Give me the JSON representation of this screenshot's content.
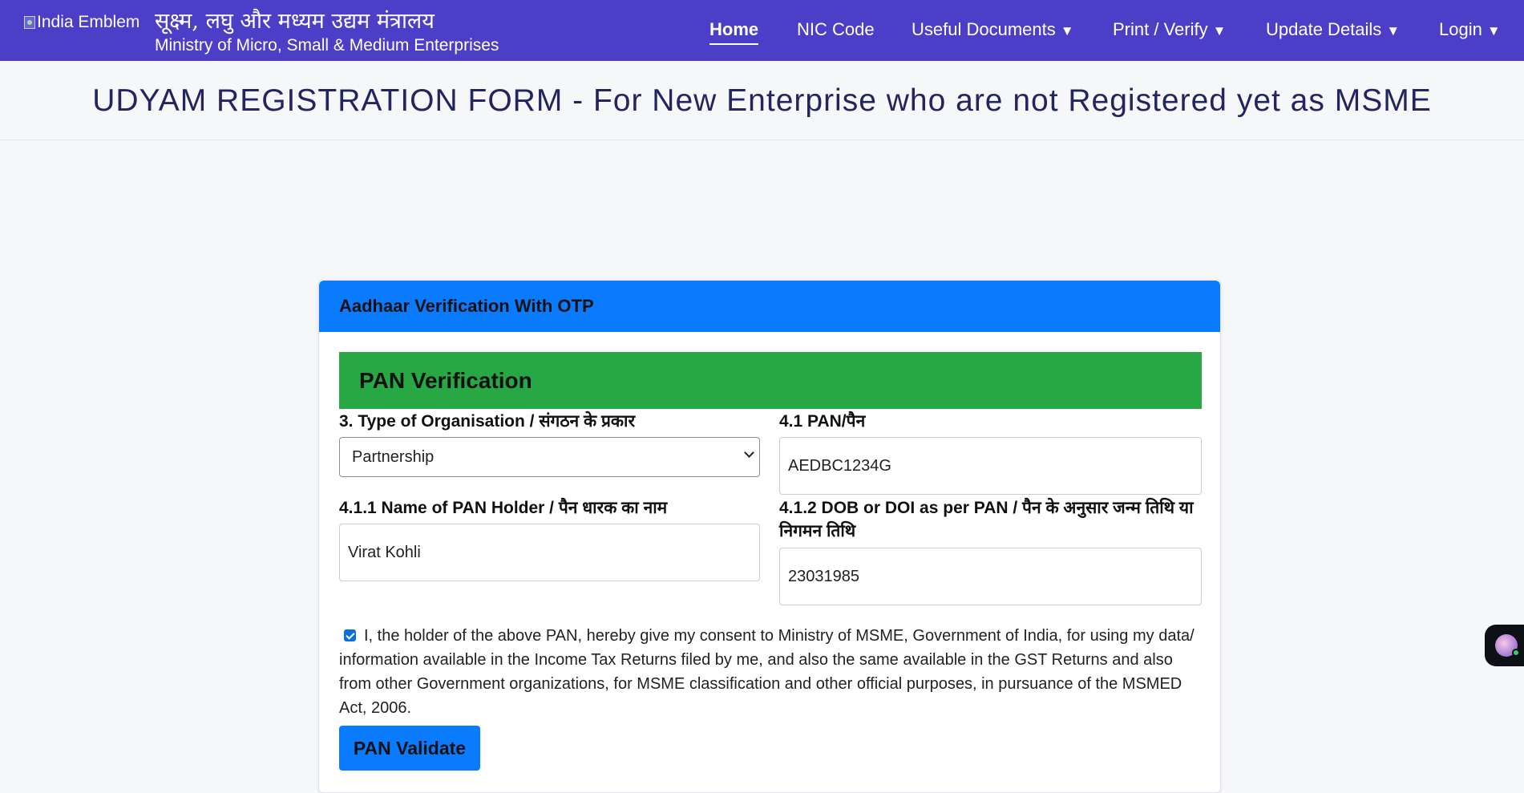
{
  "header": {
    "emblem_alt": "India Emblem",
    "ministry_hindi": "सूक्ष्म, लघु और मध्यम उद्यम मंत्रालय",
    "ministry_english": "Ministry of Micro, Small & Medium Enterprises",
    "nav": [
      {
        "label": "Home",
        "active": true
      },
      {
        "label": "NIC Code"
      },
      {
        "label": "Useful Documents",
        "caret": "▼"
      },
      {
        "label": "Print / Verify",
        "caret": "▼"
      },
      {
        "label": "Update Details",
        "caret": "▼"
      },
      {
        "label": "Login",
        "caret": "▼"
      }
    ]
  },
  "page": {
    "title": "UDYAM REGISTRATION FORM - For New Enterprise who are not Registered yet as MSME"
  },
  "card": {
    "header_title": "Aadhaar Verification With OTP",
    "section_title": "PAN Verification",
    "fields": {
      "org_type": {
        "label": "3. Type of Organisation / संगठन के प्रकार",
        "value": "Partnership"
      },
      "pan": {
        "label": "4.1 PAN/पैन",
        "value": "AEDBC1234G"
      },
      "pan_holder": {
        "label": "4.1.1 Name of PAN Holder / पैन धारक का नाम",
        "value": "Virat Kohli"
      },
      "dob": {
        "label": "4.1.2 DOB or DOI as per PAN / पैन के अनुसार जन्म तिथि या निगमन तिथि",
        "value": "23031985"
      }
    },
    "consent": {
      "checked": true,
      "text": "I, the holder of the above PAN, hereby give my consent to Ministry of MSME, Government of India, for using my data/ information available in the Income Tax Returns filed by me, and also the same available in the GST Returns and also from other Government organizations, for MSME classification and other official purposes, in pursuance of the MSMED Act, 2006."
    },
    "validate_button": "PAN Validate"
  },
  "colors": {
    "navbar": "#4a3fc6",
    "card_header": "#0a7bfd",
    "section_banner": "#28a745",
    "title_text": "#222561"
  }
}
